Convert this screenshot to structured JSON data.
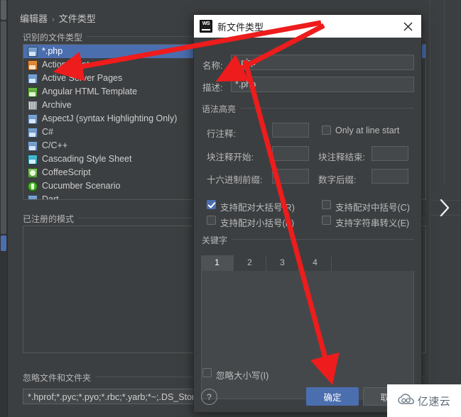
{
  "settings": {
    "breadcrumb": {
      "root": "编辑器",
      "separator": "›",
      "leaf": "文件类型"
    },
    "recognized_group_label": "识别的文件类型",
    "patterns_group_label": "已注册的模式",
    "ignore_group_label": "忽略文件和文件夹",
    "ignore_value": "*.hprof;*.pyc;*.pyo;*.rbc;*.yarb;*~;.DS_Store;.gi",
    "expand_icon": "chevron-right-icon",
    "file_types": [
      {
        "label": "*.php",
        "icon": "php-file-icon",
        "selected": true
      },
      {
        "label": "ActionScript",
        "icon": "actionscript-file-icon",
        "selected": false
      },
      {
        "label": "Active Server Pages",
        "icon": "asp-file-icon",
        "selected": false
      },
      {
        "label": "Angular HTML Template",
        "icon": "angular-html-file-icon",
        "selected": false
      },
      {
        "label": "Archive",
        "icon": "archive-file-icon",
        "selected": false
      },
      {
        "label": "AspectJ (syntax Highlighting Only)",
        "icon": "aspectj-file-icon",
        "selected": false
      },
      {
        "label": "C#",
        "icon": "csharp-file-icon",
        "selected": false
      },
      {
        "label": "C/C++",
        "icon": "cpp-file-icon",
        "selected": false
      },
      {
        "label": "Cascading Style Sheet",
        "icon": "css-file-icon",
        "selected": false
      },
      {
        "label": "CoffeeScript",
        "icon": "coffeescript-file-icon",
        "selected": false
      },
      {
        "label": "Cucumber Scenario",
        "icon": "cucumber-file-icon",
        "selected": false
      },
      {
        "label": "Dart",
        "icon": "dart-file-icon",
        "selected": false
      }
    ]
  },
  "dialog": {
    "title": "新文件类型",
    "app_icon_text": "WS",
    "close_icon": "close-icon",
    "name_label": "名称:",
    "name_value": "*.php",
    "desc_label": "描述:",
    "desc_value": "*.php",
    "syntax_group_label": "语法高亮",
    "line_comment_label": "行注释:",
    "line_comment_value": "",
    "only_at_line_start_label": "Only at line start",
    "only_at_line_start_mnemonic": "O",
    "only_at_line_start_checked": false,
    "block_comment_start_label": "块注释开始:",
    "block_comment_start_value": "",
    "block_comment_end_label": "块注释结束:",
    "block_comment_end_value": "",
    "hex_prefix_label": "十六进制前缀:",
    "hex_prefix_value": "",
    "num_suffix_label": "数字后缀:",
    "num_suffix_value": "",
    "checkboxes": [
      {
        "label": "支持配对大括号(R)",
        "checked": true,
        "name": "support-paired-braces"
      },
      {
        "label": "支持配对中括号(C)",
        "checked": false,
        "name": "support-paired-brackets"
      },
      {
        "label": "支持配对小括号(P)",
        "checked": false,
        "name": "support-paired-parens"
      },
      {
        "label": "支持字符串转义(E)",
        "checked": false,
        "name": "support-string-escapes"
      }
    ],
    "keywords_group_label": "关键字",
    "keyword_tabs": [
      "1",
      "2",
      "3",
      "4"
    ],
    "keyword_active_tab": "1",
    "ignore_case_label": "忽略大小写(I)",
    "ignore_case_checked": false,
    "help_label": "?",
    "ok_label": "确定",
    "cancel_label": "取消"
  },
  "watermark": {
    "text": "亿速云",
    "icon": "cloud-icon"
  },
  "colors": {
    "accent": "#4b6eaf",
    "window_bg": "#3c3f41",
    "input_bg": "#45484a",
    "annotation_red": "#ee1c1c",
    "titlebar_bg": "#ffffff"
  }
}
